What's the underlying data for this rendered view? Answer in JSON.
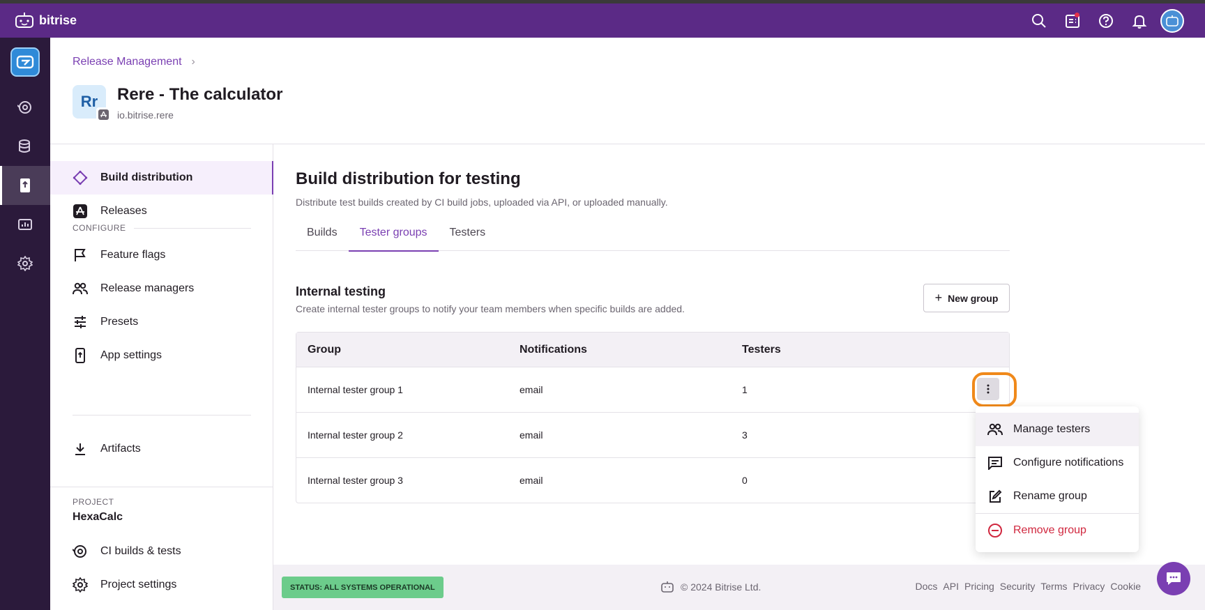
{
  "brand": {
    "name": "bitrise",
    "topbar_color": "#5b2a86"
  },
  "topbar": {
    "icons": [
      "search-icon",
      "changelog-icon",
      "help-icon",
      "bell-icon",
      "user-avatar"
    ]
  },
  "rail": {
    "items": [
      "ci-icon",
      "database-icon",
      "release-icon",
      "insights-icon",
      "settings-icon"
    ],
    "active": "release-icon"
  },
  "header": {
    "breadcrumb": "Release Management",
    "app_initials": "Rr",
    "app_title": "Rere - The calculator",
    "bundle_id": "io.bitrise.rere"
  },
  "sidenav": {
    "items": [
      {
        "label": "Build distribution",
        "icon": "diamond-icon",
        "active": true
      },
      {
        "label": "Releases",
        "icon": "app-store-icon"
      }
    ],
    "configure_label": "CONFIGURE",
    "configure_items": [
      {
        "label": "Feature flags",
        "icon": "flag-icon"
      },
      {
        "label": "Release managers",
        "icon": "people-icon"
      },
      {
        "label": "Presets",
        "icon": "sliders-icon"
      },
      {
        "label": "App settings",
        "icon": "phone-settings-icon"
      }
    ],
    "artifacts": {
      "label": "Artifacts",
      "icon": "download-icon"
    },
    "project_label": "PROJECT",
    "project_name": "HexaCalc",
    "project_items": [
      {
        "label": "CI builds & tests",
        "icon": "ci-icon"
      },
      {
        "label": "Project settings",
        "icon": "gear-icon"
      }
    ]
  },
  "main": {
    "title": "Build distribution for testing",
    "description": "Distribute test builds created by CI build jobs, uploaded via API, or uploaded manually.",
    "tabs": [
      {
        "label": "Builds"
      },
      {
        "label": "Tester groups",
        "active": true
      },
      {
        "label": "Testers"
      }
    ],
    "section_title": "Internal testing",
    "section_desc": "Create internal tester groups to notify your team members when specific builds are added.",
    "new_group_label": "New group",
    "table": {
      "headers": [
        "Group",
        "Notifications",
        "Testers"
      ],
      "rows": [
        {
          "group": "Internal tester group 1",
          "notifications": "email",
          "testers": "1"
        },
        {
          "group": "Internal tester group 2",
          "notifications": "email",
          "testers": "3"
        },
        {
          "group": "Internal tester group 3",
          "notifications": "email",
          "testers": "0"
        }
      ]
    }
  },
  "menu": {
    "items": [
      {
        "label": "Manage testers",
        "icon": "people-icon"
      },
      {
        "label": "Configure notifications",
        "icon": "message-icon"
      },
      {
        "label": "Rename group",
        "icon": "edit-icon"
      },
      {
        "label": "Remove group",
        "icon": "minus-circle-icon",
        "danger": true
      }
    ]
  },
  "footer": {
    "status": "STATUS: ALL SYSTEMS OPERATIONAL",
    "copyright": "© 2024 Bitrise Ltd.",
    "links": [
      "Docs",
      "API",
      "Pricing",
      "Security",
      "Terms",
      "Privacy",
      "Cookie"
    ]
  },
  "colors": {
    "accent": "#7a3fb2",
    "danger": "#d0273e",
    "highlight": "#f0891a",
    "status": "#6ccc8b"
  }
}
